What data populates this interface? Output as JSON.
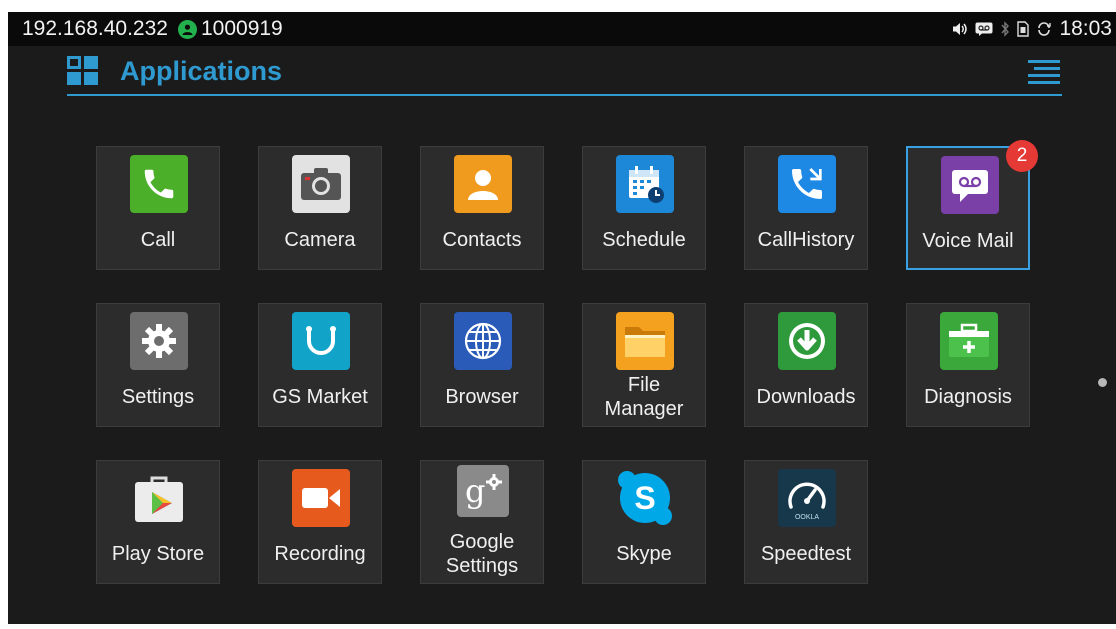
{
  "status_bar": {
    "ip": "192.168.40.232",
    "extension": "1000919",
    "time": "18:03",
    "icons": [
      "user-status-icon",
      "volume-icon",
      "voicemail-icon",
      "bluetooth-icon",
      "sim-icon",
      "sync-icon"
    ]
  },
  "header": {
    "title": "Applications",
    "menu_icon": "list-menu-icon",
    "accent_color": "#2e9ad0"
  },
  "apps": [
    {
      "id": "call",
      "label": "Call",
      "icon": "phone-icon",
      "color": "#4caf2a"
    },
    {
      "id": "camera",
      "label": "Camera",
      "icon": "camera-icon",
      "color": "#e2e2e2"
    },
    {
      "id": "contacts",
      "label": "Contacts",
      "icon": "contacts-icon",
      "color": "#f09a1e"
    },
    {
      "id": "schedule",
      "label": "Schedule",
      "icon": "calendar-icon",
      "color": "#1e88d8"
    },
    {
      "id": "callhistory",
      "label": "CallHistory",
      "icon": "call-history-icon",
      "color": "#1e88e5"
    },
    {
      "id": "voicemail",
      "label": "Voice Mail",
      "icon": "voicemail-icon",
      "color": "#7b3fa8",
      "badge": "2",
      "selected": true
    },
    {
      "id": "settings",
      "label": "Settings",
      "icon": "gear-icon",
      "color": "#6d6d6d"
    },
    {
      "id": "gsmarket",
      "label": "GS Market",
      "icon": "market-bag-icon",
      "color": "#12a4c8"
    },
    {
      "id": "browser",
      "label": "Browser",
      "icon": "globe-icon",
      "color": "#2a5bb8"
    },
    {
      "id": "filemanager",
      "label_line1": "File",
      "label_line2": "Manager",
      "icon": "folder-icon",
      "color": "#f3a11e"
    },
    {
      "id": "downloads",
      "label": "Downloads",
      "icon": "download-icon",
      "color": "#2e9a3c"
    },
    {
      "id": "diagnosis",
      "label": "Diagnosis",
      "icon": "first-aid-kit-icon",
      "color": "#3aa83a"
    },
    {
      "id": "playstore",
      "label": "Play Store",
      "icon": "play-store-icon",
      "color": "#e8e8e8"
    },
    {
      "id": "recording",
      "label": "Recording",
      "icon": "video-camera-icon",
      "color": "#e65a1e"
    },
    {
      "id": "googlesettings",
      "label_line1": "Google",
      "label_line2": "Settings",
      "icon": "google-settings-icon",
      "color": "#8a8a8a"
    },
    {
      "id": "skype",
      "label": "Skype",
      "icon": "skype-icon",
      "color": "#00a8e8"
    },
    {
      "id": "speedtest",
      "label": "Speedtest",
      "icon": "speedometer-icon",
      "color": "#16384a",
      "sublabel": "OOKLA"
    }
  ],
  "pager": {
    "icon": "page-indicator-dot"
  }
}
